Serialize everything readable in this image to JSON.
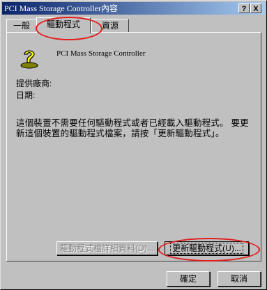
{
  "window": {
    "title": "PCI Mass Storage Controller內容",
    "help_button": "?",
    "close_button": "X"
  },
  "tabs": [
    {
      "label": "一般"
    },
    {
      "label": "驅動程式"
    },
    {
      "label": "資源"
    }
  ],
  "device": {
    "name": "PCI Mass Storage Controller",
    "icon": "question-mark-icon",
    "provider_label": "提供廠商:",
    "date_label": "日期:",
    "description": "這個裝置不需要任何驅動程式或者已經載入驅動程式。 要更新這個裝置的驅動程式檔案，請按「更新驅動程式」。"
  },
  "buttons": {
    "driver_details": "驅動程式檔詳細資料(D)...",
    "update_driver": "更新驅動程式(U)...",
    "ok": "確定",
    "cancel": "取消"
  },
  "colors": {
    "title_start": "#0a246a",
    "title_end": "#a6caf0",
    "highlight": "#e31b1b",
    "icon_yellow": "#ffff00"
  }
}
